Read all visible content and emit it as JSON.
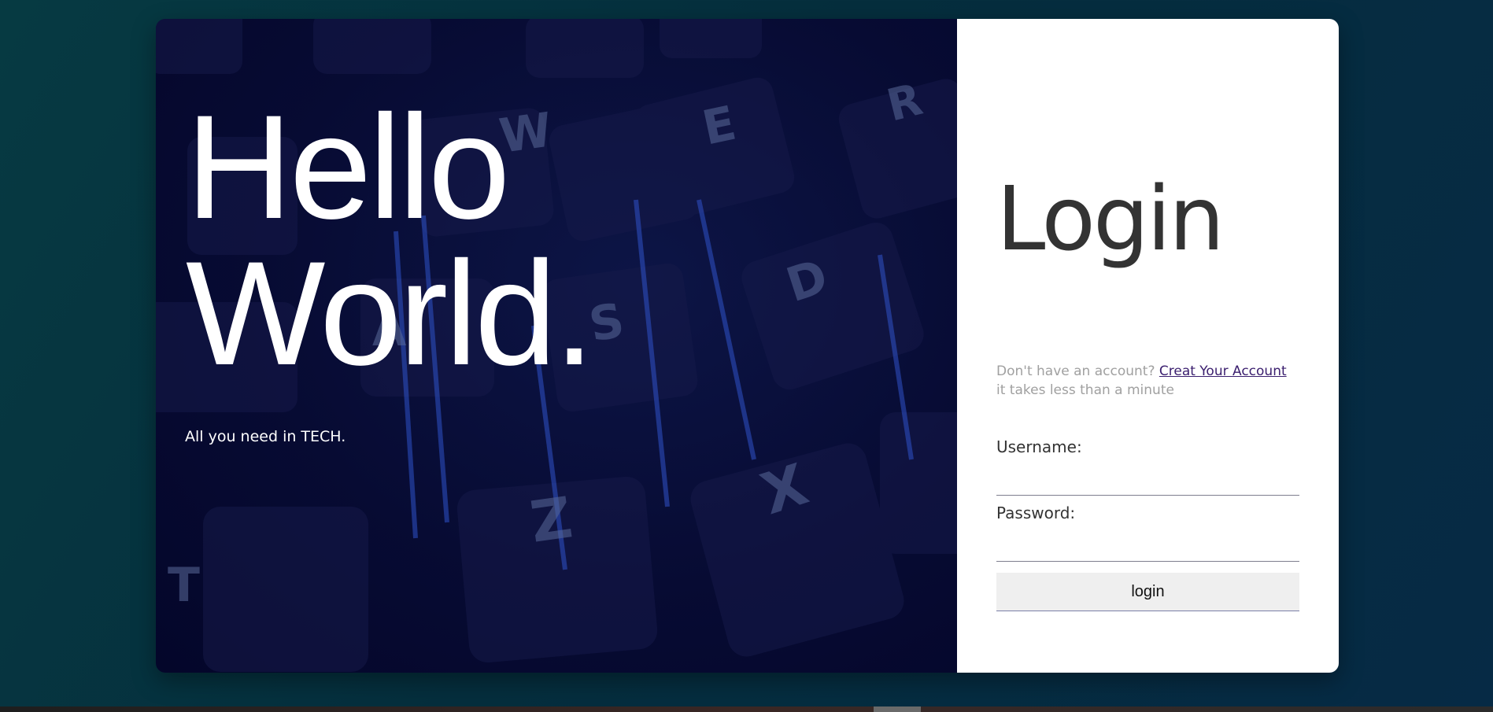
{
  "hero": {
    "title_line1": "Hello",
    "title_line2": "World.",
    "subtitle": "All you need in TECH.",
    "key_letters": [
      "W",
      "E",
      "R",
      "S",
      "D",
      "A",
      "Z",
      "X",
      "T"
    ]
  },
  "login": {
    "title": "Login",
    "signup_prefix": "Don't have an account?",
    "signup_link": "Creat Your Account",
    "signup_suffix": "it takes less than a minute",
    "username_label": "Username:",
    "username_value": "",
    "password_label": "Password:",
    "password_value": "",
    "button_label": "login"
  },
  "colors": {
    "background": "#063a42",
    "hero_background": "#070b33",
    "panel_background": "#ffffff",
    "link": "#3a1e6e",
    "muted_text": "#a0a0a0",
    "button_background": "#efefef"
  }
}
